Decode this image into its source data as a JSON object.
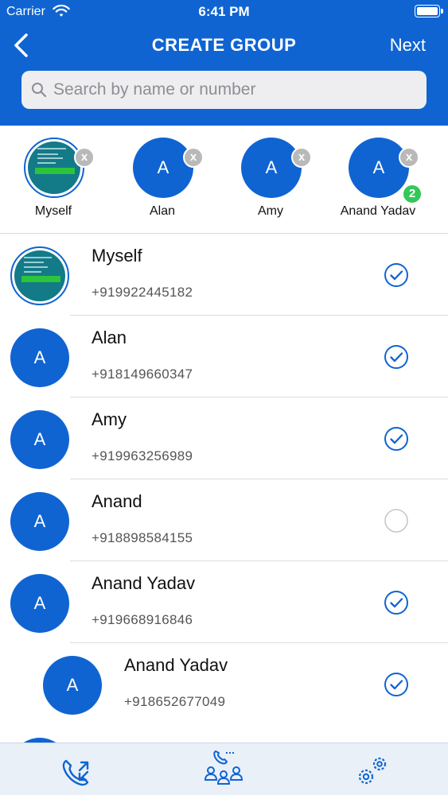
{
  "status_bar": {
    "carrier": "Carrier",
    "time": "6:41 PM",
    "wifi_icon": "wifi-icon",
    "battery_icon": "battery-icon"
  },
  "nav": {
    "back_icon": "chevron-left-icon",
    "title": "CREATE GROUP",
    "next_label": "Next"
  },
  "search": {
    "placeholder": "Search by name or number",
    "value": "",
    "icon": "search-icon"
  },
  "selected_members": [
    {
      "name": "Myself",
      "avatar_type": "photo",
      "initial": "",
      "remove_label": "x"
    },
    {
      "name": "Alan",
      "avatar_type": "initial",
      "initial": "A",
      "remove_label": "x"
    },
    {
      "name": "Amy",
      "avatar_type": "initial",
      "initial": "A",
      "remove_label": "x"
    },
    {
      "name": "Anand Yadav",
      "avatar_type": "initial",
      "initial": "A",
      "remove_label": "x",
      "badge": "2"
    }
  ],
  "contacts": [
    {
      "name": "Myself",
      "phone": "+919922445182",
      "avatar_type": "photo",
      "initial": "",
      "checked": true
    },
    {
      "name": "Alan",
      "phone": "+918149660347",
      "avatar_type": "initial",
      "initial": "A",
      "checked": true
    },
    {
      "name": "Amy",
      "phone": "+919963256989",
      "avatar_type": "initial",
      "initial": "A",
      "checked": true
    },
    {
      "name": "Anand",
      "phone": "+918898584155",
      "avatar_type": "initial",
      "initial": "A",
      "checked": false
    },
    {
      "name": "Anand Yadav",
      "phone": "+919668916846",
      "avatar_type": "initial",
      "initial": "A",
      "checked": true
    },
    {
      "name": "Anand Yadav",
      "phone": "+918652677049",
      "avatar_type": "initial",
      "initial": "A",
      "checked": true
    }
  ],
  "tabbar": {
    "tabs": [
      {
        "icon": "call-log-icon"
      },
      {
        "icon": "group-call-icon"
      },
      {
        "icon": "settings-gears-icon"
      }
    ]
  },
  "colors": {
    "primary": "#0f64d2",
    "badge_green": "#34c759",
    "remove_gray": "#b9b9b9",
    "unchecked": "#c7c7cc"
  }
}
